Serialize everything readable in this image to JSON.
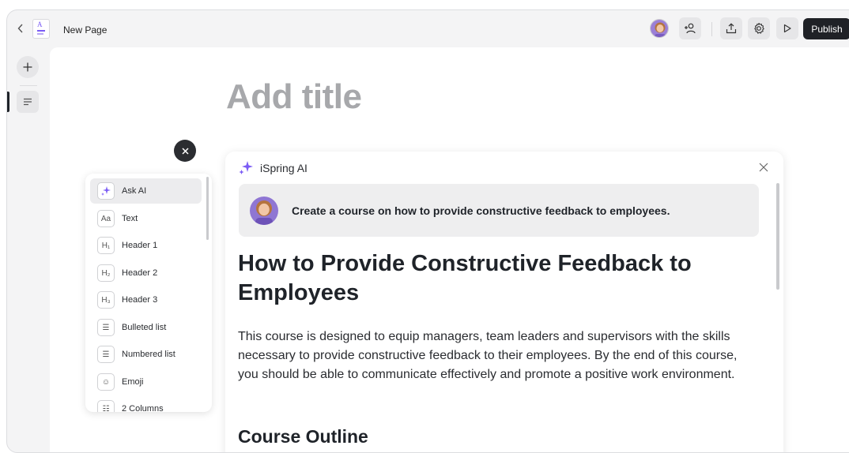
{
  "topbar": {
    "doc_title": "New Page",
    "doc_thumb_letter": "A",
    "publish_label": "Publish"
  },
  "canvas": {
    "title_placeholder": "Add title"
  },
  "block_menu": {
    "items": [
      {
        "icon": "sparkle-icon",
        "label": "Ask AI"
      },
      {
        "icon": "text-icon",
        "glyph": "Aa",
        "label": "Text"
      },
      {
        "icon": "header-1-icon",
        "glyph": "H₁",
        "label": "Header 1"
      },
      {
        "icon": "header-2-icon",
        "glyph": "H₂",
        "label": "Header 2"
      },
      {
        "icon": "header-3-icon",
        "glyph": "H₃",
        "label": "Header 3"
      },
      {
        "icon": "bulleted-list-icon",
        "glyph": "☰",
        "label": "Bulleted list"
      },
      {
        "icon": "numbered-list-icon",
        "glyph": "☰",
        "label": "Numbered list"
      },
      {
        "icon": "emoji-icon",
        "glyph": "☺",
        "label": "Emoji"
      },
      {
        "icon": "two-columns-icon",
        "glyph": "☷",
        "label": "2 Columns"
      }
    ]
  },
  "ai_panel": {
    "title": "iSpring AI",
    "prompt": "Create a course on how to provide constructive feedback to employees.",
    "heading": "How to Provide Constructive Feedback to Employees",
    "paragraph": "This course is designed to equip managers, team leaders and supervisors with the skills necessary to provide constructive feedback to their employees. By the end of this course, you should be able to communicate effectively and promote a positive work environment.",
    "subheading": "Course Outline"
  },
  "colors": {
    "accent": "#7b5cf5",
    "publish_bg": "#1f2126"
  }
}
